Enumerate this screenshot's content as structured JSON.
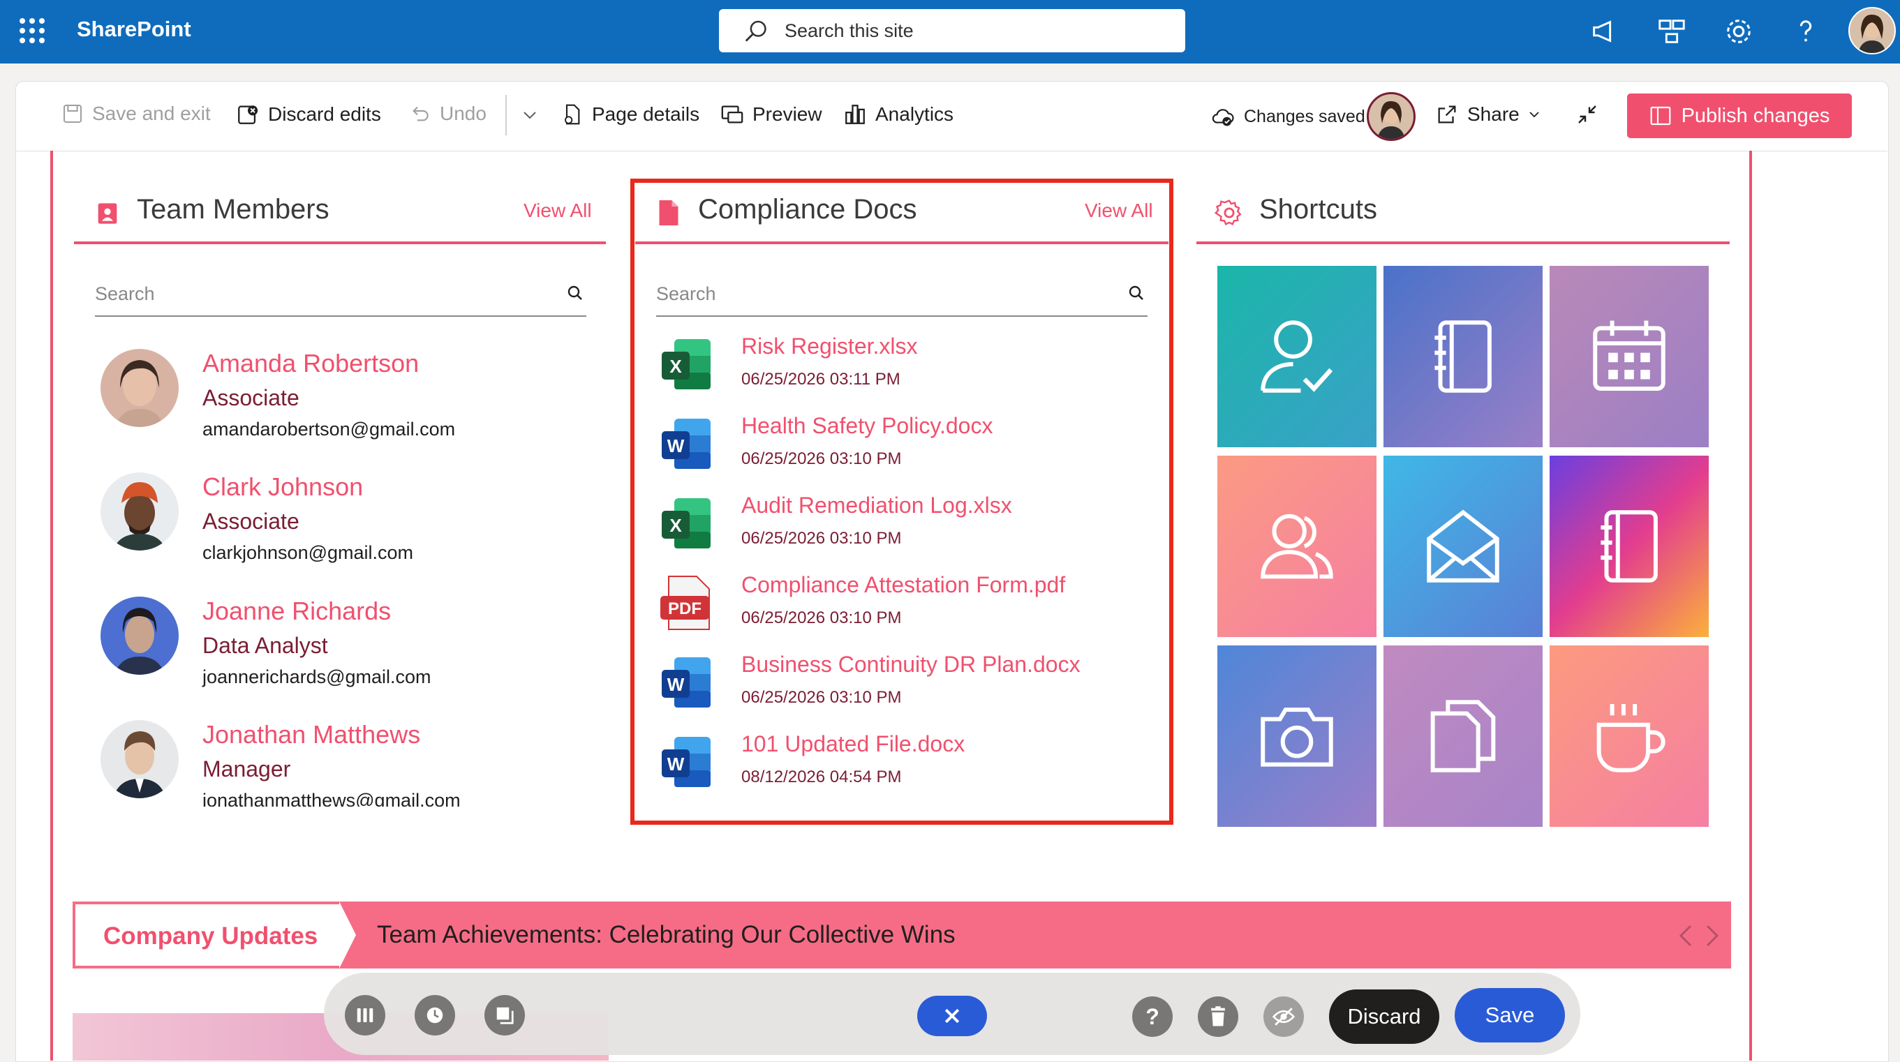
{
  "suite": {
    "brand": "SharePoint",
    "search_placeholder": "Search this site"
  },
  "command_bar": {
    "save_exit": "Save and exit",
    "discard_edits": "Discard edits",
    "undo": "Undo",
    "page_details": "Page details",
    "preview": "Preview",
    "analytics": "Analytics",
    "changes_saved": "Changes saved",
    "share": "Share",
    "publish": "Publish changes"
  },
  "team_members": {
    "title": "Team Members",
    "view_all": "View All",
    "search_placeholder": "Search",
    "people": [
      {
        "name": "Amanda Robertson",
        "role": "Associate",
        "email": "amandarobertson@gmail.com"
      },
      {
        "name": "Clark Johnson",
        "role": "Associate",
        "email": "clarkjohnson@gmail.com"
      },
      {
        "name": "Joanne Richards",
        "role": "Data Analyst",
        "email": "joannerichards@gmail.com"
      },
      {
        "name": "Jonathan Matthews",
        "role": "Manager",
        "email": "jonathanmatthews@gmail.com"
      }
    ]
  },
  "compliance_docs": {
    "title": "Compliance Docs",
    "view_all": "View All",
    "search_placeholder": "Search",
    "docs": [
      {
        "name": "Risk Register.xlsx",
        "date": "06/25/2026 03:11 PM",
        "type": "excel"
      },
      {
        "name": "Health Safety Policy.docx",
        "date": "06/25/2026 03:10 PM",
        "type": "word"
      },
      {
        "name": "Audit Remediation Log.xlsx",
        "date": "06/25/2026 03:10 PM",
        "type": "excel"
      },
      {
        "name": "Compliance Attestation Form.pdf",
        "date": "06/25/2026 03:10 PM",
        "type": "pdf"
      },
      {
        "name": "Business Continuity DR Plan.docx",
        "date": "06/25/2026 03:10 PM",
        "type": "word"
      },
      {
        "name": "101 Updated File.docx",
        "date": "08/12/2026 04:54 PM",
        "type": "word"
      }
    ]
  },
  "shortcuts": {
    "title": "Shortcuts",
    "tiles": [
      "user-check-icon",
      "notebook-icon",
      "calendar-icon",
      "users-icon",
      "mail-icon",
      "notebook-icon",
      "camera-icon",
      "documents-icon",
      "coffee-icon"
    ]
  },
  "company_updates": {
    "label": "Company Updates",
    "headline": "Team Achievements: Celebrating Our Collective Wins"
  },
  "bottom_toolbar": {
    "discard": "Discard",
    "save": "Save"
  },
  "icons": {
    "excel_letter": "X",
    "word_letter": "W",
    "pdf_label": "PDF",
    "help_glyph": "?"
  },
  "colors": {
    "suite_blue": "#0f6cbd",
    "accent_pink": "#f0506e",
    "role_maroon": "#7a1d33",
    "highlight_red": "#e8291b",
    "save_blue": "#2a5bd7"
  }
}
